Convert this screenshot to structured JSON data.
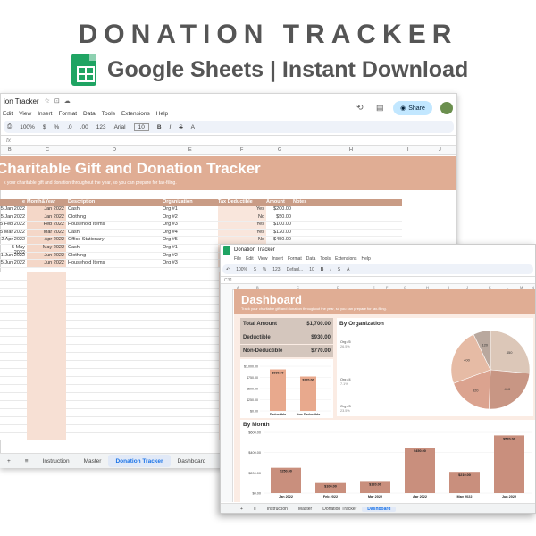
{
  "header": {
    "title": "DONATION TRACKER",
    "subtitle": "Google Sheets | Instant Download"
  },
  "back_window": {
    "doc_title": "ion Tracker",
    "menu": [
      "Edit",
      "View",
      "Insert",
      "Format",
      "Data",
      "Tools",
      "Extensions",
      "Help"
    ],
    "toolbar": [
      "100%",
      "$",
      "%",
      ".0",
      ".00",
      "123",
      "Arial",
      "10",
      "B",
      "I",
      "S",
      "A"
    ],
    "share_label": "Share",
    "fx_label": "fx",
    "columns": [
      "B",
      "C",
      "D",
      "E",
      "F",
      "G",
      "H",
      "I",
      "J"
    ],
    "banner_title": "Charitable Gift and Donation Tracker",
    "banner_sub": "k your charitable gift and donation throughout the year, so you can prepare for tax-filing.",
    "table_headers": [
      "e",
      "Month&Year",
      "Description",
      "Organization",
      "Tax Deductible",
      "Amount",
      "Notes"
    ],
    "rows": [
      [
        "5 Jan 2022",
        "Jan 2022",
        "Cash",
        "Org #1",
        "Yes",
        "$200.00"
      ],
      [
        "5 Jan 2022",
        "Jan 2022",
        "Clothing",
        "Org #2",
        "No",
        "$50.00"
      ],
      [
        "5 Feb 2022",
        "Feb 2022",
        "Household Items",
        "Org #3",
        "Yes",
        "$100.00"
      ],
      [
        "5 Mar 2022",
        "Mar 2022",
        "Cash",
        "Org #4",
        "Yes",
        "$120.00"
      ],
      [
        "2 Apr 2022",
        "Apr 2022",
        "Office Stationary",
        "Org #5",
        "No",
        "$450.00"
      ],
      [
        "5 May 2022",
        "May 2022",
        "Cash",
        "Org #1",
        "Yes",
        ""
      ],
      [
        "1 Jun 2022",
        "Jun 2022",
        "Clothing",
        "Org #2",
        "Yes",
        ""
      ],
      [
        "5 Jun 2022",
        "Jun 2022",
        "Household Items",
        "Org #3",
        "",
        ""
      ]
    ],
    "tabs": [
      "Instruction",
      "Master",
      "Donation Tracker",
      "Dashboard"
    ],
    "active_tab": "Donation Tracker"
  },
  "front_window": {
    "doc_title": "Donation Tracker",
    "menu": [
      "File",
      "Edit",
      "View",
      "Insert",
      "Format",
      "Data",
      "Tools",
      "Extensions",
      "Help"
    ],
    "toolbar": [
      "100%",
      "$",
      "%",
      "123",
      "Defaul...",
      "10",
      "B",
      "I",
      "S",
      "A"
    ],
    "cell_ref": "C31",
    "columns": [
      "A",
      "B",
      "C",
      "D",
      "E",
      "F",
      "G",
      "H",
      "I",
      "J",
      "K",
      "L",
      "M",
      "N"
    ],
    "dash_title": "Dashboard",
    "dash_sub": "Track your charitable gift and donation throughout the year, so you can prepare for tax-filing.",
    "kpis": [
      {
        "label": "Total Amount",
        "value": "$1,700.00"
      },
      {
        "label": "Deductible",
        "value": "$930.00"
      },
      {
        "label": "Non-Deductible",
        "value": "$770.00"
      }
    ],
    "by_org_title": "By Organization",
    "by_month_title": "By Month",
    "tabs": [
      "Instruction",
      "Master",
      "Donation Tracker",
      "Dashboard"
    ],
    "active_tab": "Dashboard"
  },
  "chart_data": [
    {
      "type": "bar",
      "title": "",
      "categories": [
        "Deductible",
        "Non-Deductible"
      ],
      "values": [
        930,
        770
      ],
      "data_labels": [
        "$930.00",
        "$770.00"
      ],
      "ylim": [
        0,
        1000
      ],
      "y_ticks": [
        "$0.00",
        "$250.00",
        "$500.00",
        "$750.00",
        "$1,000.00"
      ],
      "color": "#e8a98d"
    },
    {
      "type": "pie",
      "title": "By Organization",
      "categories": [
        "Org #5",
        "Org #1",
        "Org #2",
        "Org #3",
        "Org #4"
      ],
      "values": [
        450,
        410,
        320,
        400,
        120
      ],
      "legend_labels": [
        "Org #5",
        "Org #4",
        "Org #3"
      ],
      "legend_pcts": [
        "26.5%",
        "7.1%",
        "23.5%"
      ],
      "colors": [
        "#dcc7b8",
        "#c89684",
        "#dba38f",
        "#e6bba5",
        "#b9a89e"
      ]
    },
    {
      "type": "bar",
      "title": "By Month",
      "categories": [
        "Jan 2022",
        "Feb 2022",
        "Mar 2022",
        "Apr 2022",
        "May 2022",
        "Jun 2022"
      ],
      "values": [
        250,
        100,
        120,
        450,
        210,
        570
      ],
      "data_labels": [
        "$250.00",
        "$100.00",
        "$120.00",
        "$450.00",
        "$210.00",
        "$570.00"
      ],
      "ylim": [
        0,
        600
      ],
      "y_ticks": [
        "$0.00",
        "$200.00",
        "$400.00",
        "$600.00"
      ],
      "color": "#c98f7d"
    }
  ]
}
